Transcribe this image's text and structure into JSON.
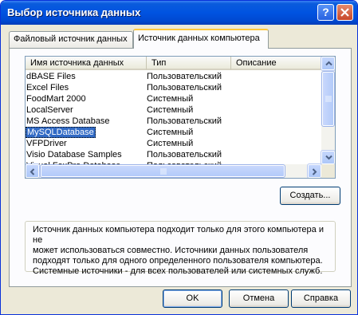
{
  "window": {
    "title": "Выбор источника данных",
    "help_glyph": "?"
  },
  "tabs": [
    {
      "label": "Файловый источник данных",
      "active": false
    },
    {
      "label": "Источник данных компьютера",
      "active": true
    }
  ],
  "list": {
    "columns": [
      "Имя источника данных",
      "Тип",
      "Описание"
    ],
    "rows": [
      {
        "name": "dBASE Files",
        "type": "Пользовательский"
      },
      {
        "name": "Excel Files",
        "type": "Пользовательский"
      },
      {
        "name": "FoodMart 2000",
        "type": "Системный"
      },
      {
        "name": "LocalServer",
        "type": "Системный"
      },
      {
        "name": "MS Access Database",
        "type": "Пользовательский"
      },
      {
        "name": "MySQLDatabase",
        "type": "Системный",
        "selected": true
      },
      {
        "name": "VFPDriver",
        "type": "Системный"
      },
      {
        "name": "Visio Database Samples",
        "type": "Пользовательский"
      },
      {
        "name": "Visual FoxPro Database",
        "type": "Пользовательский"
      }
    ]
  },
  "create_button": "Создать...",
  "info_text": [
    "Источник данных компьютера подходит только для этого компьютера и не",
    "может использоваться совместно.  Источники данных пользователя",
    "подходят только для одного определенного пользователя компьютера.",
    "Системные источники - для всех пользователей или системных служб."
  ],
  "buttons": {
    "ok": "OK",
    "cancel": "Отмена",
    "help": "Справка"
  },
  "colors": {
    "titlebar": "#0053e1",
    "selection": "#316ac5",
    "active_tab_accent": "#ffc83c"
  }
}
